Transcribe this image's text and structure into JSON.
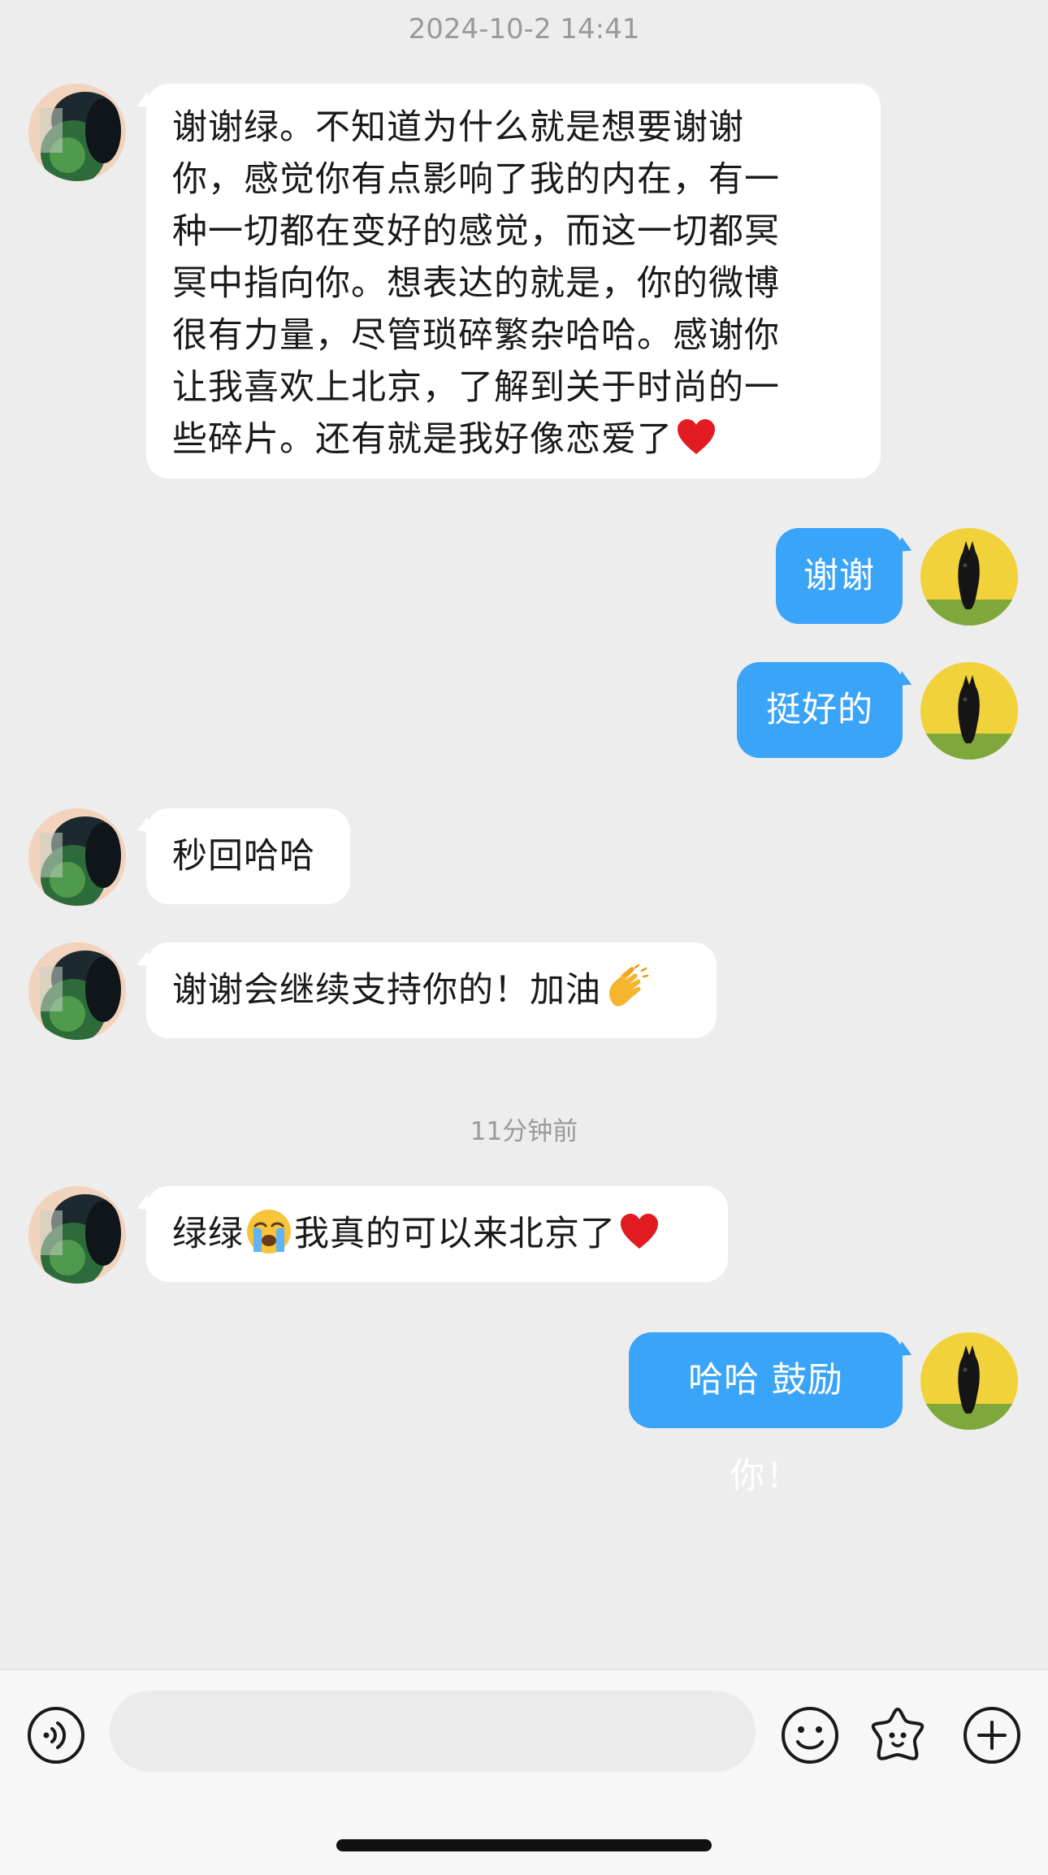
{
  "chat": {
    "timestamps": {
      "first": "2024-10-2 14:41",
      "second": "11分钟前"
    },
    "messages": [
      {
        "id": "m1",
        "direction": "incoming",
        "lines": [
          "谢谢绿。不知道为什么就是想要谢谢",
          "你，感觉你有点影响了我的内在，有一",
          "种一切都在变好的感觉，而这一切都冥",
          "冥中指向你。想表达的就是，你的微博",
          "很有力量，尽管琐碎繁杂哈哈。感谢你",
          "让我喜欢上北京，了解到关于时尚的一",
          "些碎片。还有就是我好像恋爱了"
        ],
        "trailing_emoji": "red-heart"
      },
      {
        "id": "m2",
        "direction": "outgoing",
        "text": "谢谢"
      },
      {
        "id": "m3",
        "direction": "outgoing",
        "text": "挺好的"
      },
      {
        "id": "m4",
        "direction": "incoming",
        "text": "秒回哈哈"
      },
      {
        "id": "m5",
        "direction": "incoming",
        "text": "谢谢会继续支持你的！加油",
        "trailing_emoji": "clapping-hands"
      },
      {
        "id": "m6",
        "direction": "incoming",
        "text_before_emoji": "绿绿",
        "inline_emoji": "loudly-crying-face",
        "text_after_emoji": "我真的可以来北京了",
        "trailing_emoji": "red-heart"
      },
      {
        "id": "m7",
        "direction": "outgoing",
        "text": "哈哈 鼓励你！"
      }
    ]
  },
  "input_bar": {
    "placeholder": "",
    "icons": [
      "voice-icon",
      "emoji-face-icon",
      "sticker-star-icon",
      "plus-icon"
    ]
  },
  "colors": {
    "background": "#ededed",
    "incoming_bubble": "#ffffff",
    "outgoing_bubble": "#3aa4f8",
    "timestamp_text": "#9a9a9a",
    "input_bar": "#f7f7f7"
  }
}
